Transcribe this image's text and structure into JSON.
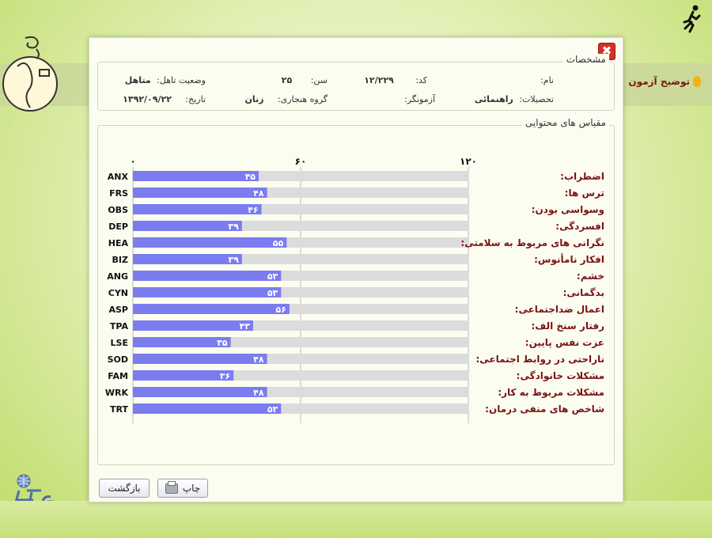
{
  "background": {
    "help_label": "توضیح آزمون"
  },
  "dialog": {
    "close_glyph": "✖",
    "info": {
      "legend": "مشخصات",
      "name_label": "نام:",
      "name_value": "",
      "code_label": "کد:",
      "code_value": "۱۲/۲۲۹",
      "age_label": "سن:",
      "age_value": "۲۵",
      "marital_label": "وضعیت تاهل:",
      "marital_value": "متاهل",
      "education_label": "تحصیلات:",
      "education_value": "راهنمائی",
      "examiner_label": "آزمونگر:",
      "examiner_value": "",
      "norm_group_label": "گروه هنجاری:",
      "norm_group_value": "زنان",
      "date_label": "تاریخ:",
      "date_value": "۱۳۹۲/۰۹/۲۲"
    },
    "scales": {
      "legend": "مقیاس های محتوایی"
    },
    "buttons": {
      "print_label": "چاپ",
      "back_label": "بازگشت"
    }
  },
  "chart_data": {
    "type": "bar",
    "orientation": "horizontal",
    "ylim": [
      0,
      120
    ],
    "axis_ticks": [
      {
        "value": 0,
        "label": "۰"
      },
      {
        "value": 60,
        "label": "۶۰"
      },
      {
        "value": 120,
        "label": "۱۲۰"
      }
    ],
    "grid": true,
    "bar_color": "#7b7cf0",
    "track_color": "#dcdcdc",
    "label_color": "#7a1414",
    "categories": [
      "ANX",
      "FRS",
      "OBS",
      "DEP",
      "HEA",
      "BIZ",
      "ANG",
      "CYN",
      "ASP",
      "TPA",
      "LSE",
      "SOD",
      "FAM",
      "WRK",
      "TRT"
    ],
    "category_names": [
      "اضطراب:",
      "ترس ها:",
      "وسواسی بودن:",
      "افسردگی:",
      "نگرانی های مربوط به سلامتی:",
      "افکار نامأنوس:",
      "خشم:",
      "بدگمانی:",
      "اعمال ضداجتماعی:",
      "رفتار سنخ الف:",
      "عزت نفس پایین:",
      "ناراحتی در روابط اجتماعی:",
      "مشکلات خانوادگی:",
      "مشکلات مربوط به کار:",
      "شاخص های منفی درمان:"
    ],
    "values": [
      45,
      48,
      46,
      39,
      55,
      39,
      53,
      53,
      56,
      43,
      35,
      48,
      36,
      48,
      53
    ],
    "value_labels": [
      "۴۵",
      "۴۸",
      "۴۶",
      "۳۹",
      "۵۵",
      "۳۹",
      "۵۳",
      "۵۳",
      "۵۶",
      "۴۳",
      "۳۵",
      "۴۸",
      "۳۶",
      "۴۸",
      "۵۳"
    ]
  }
}
